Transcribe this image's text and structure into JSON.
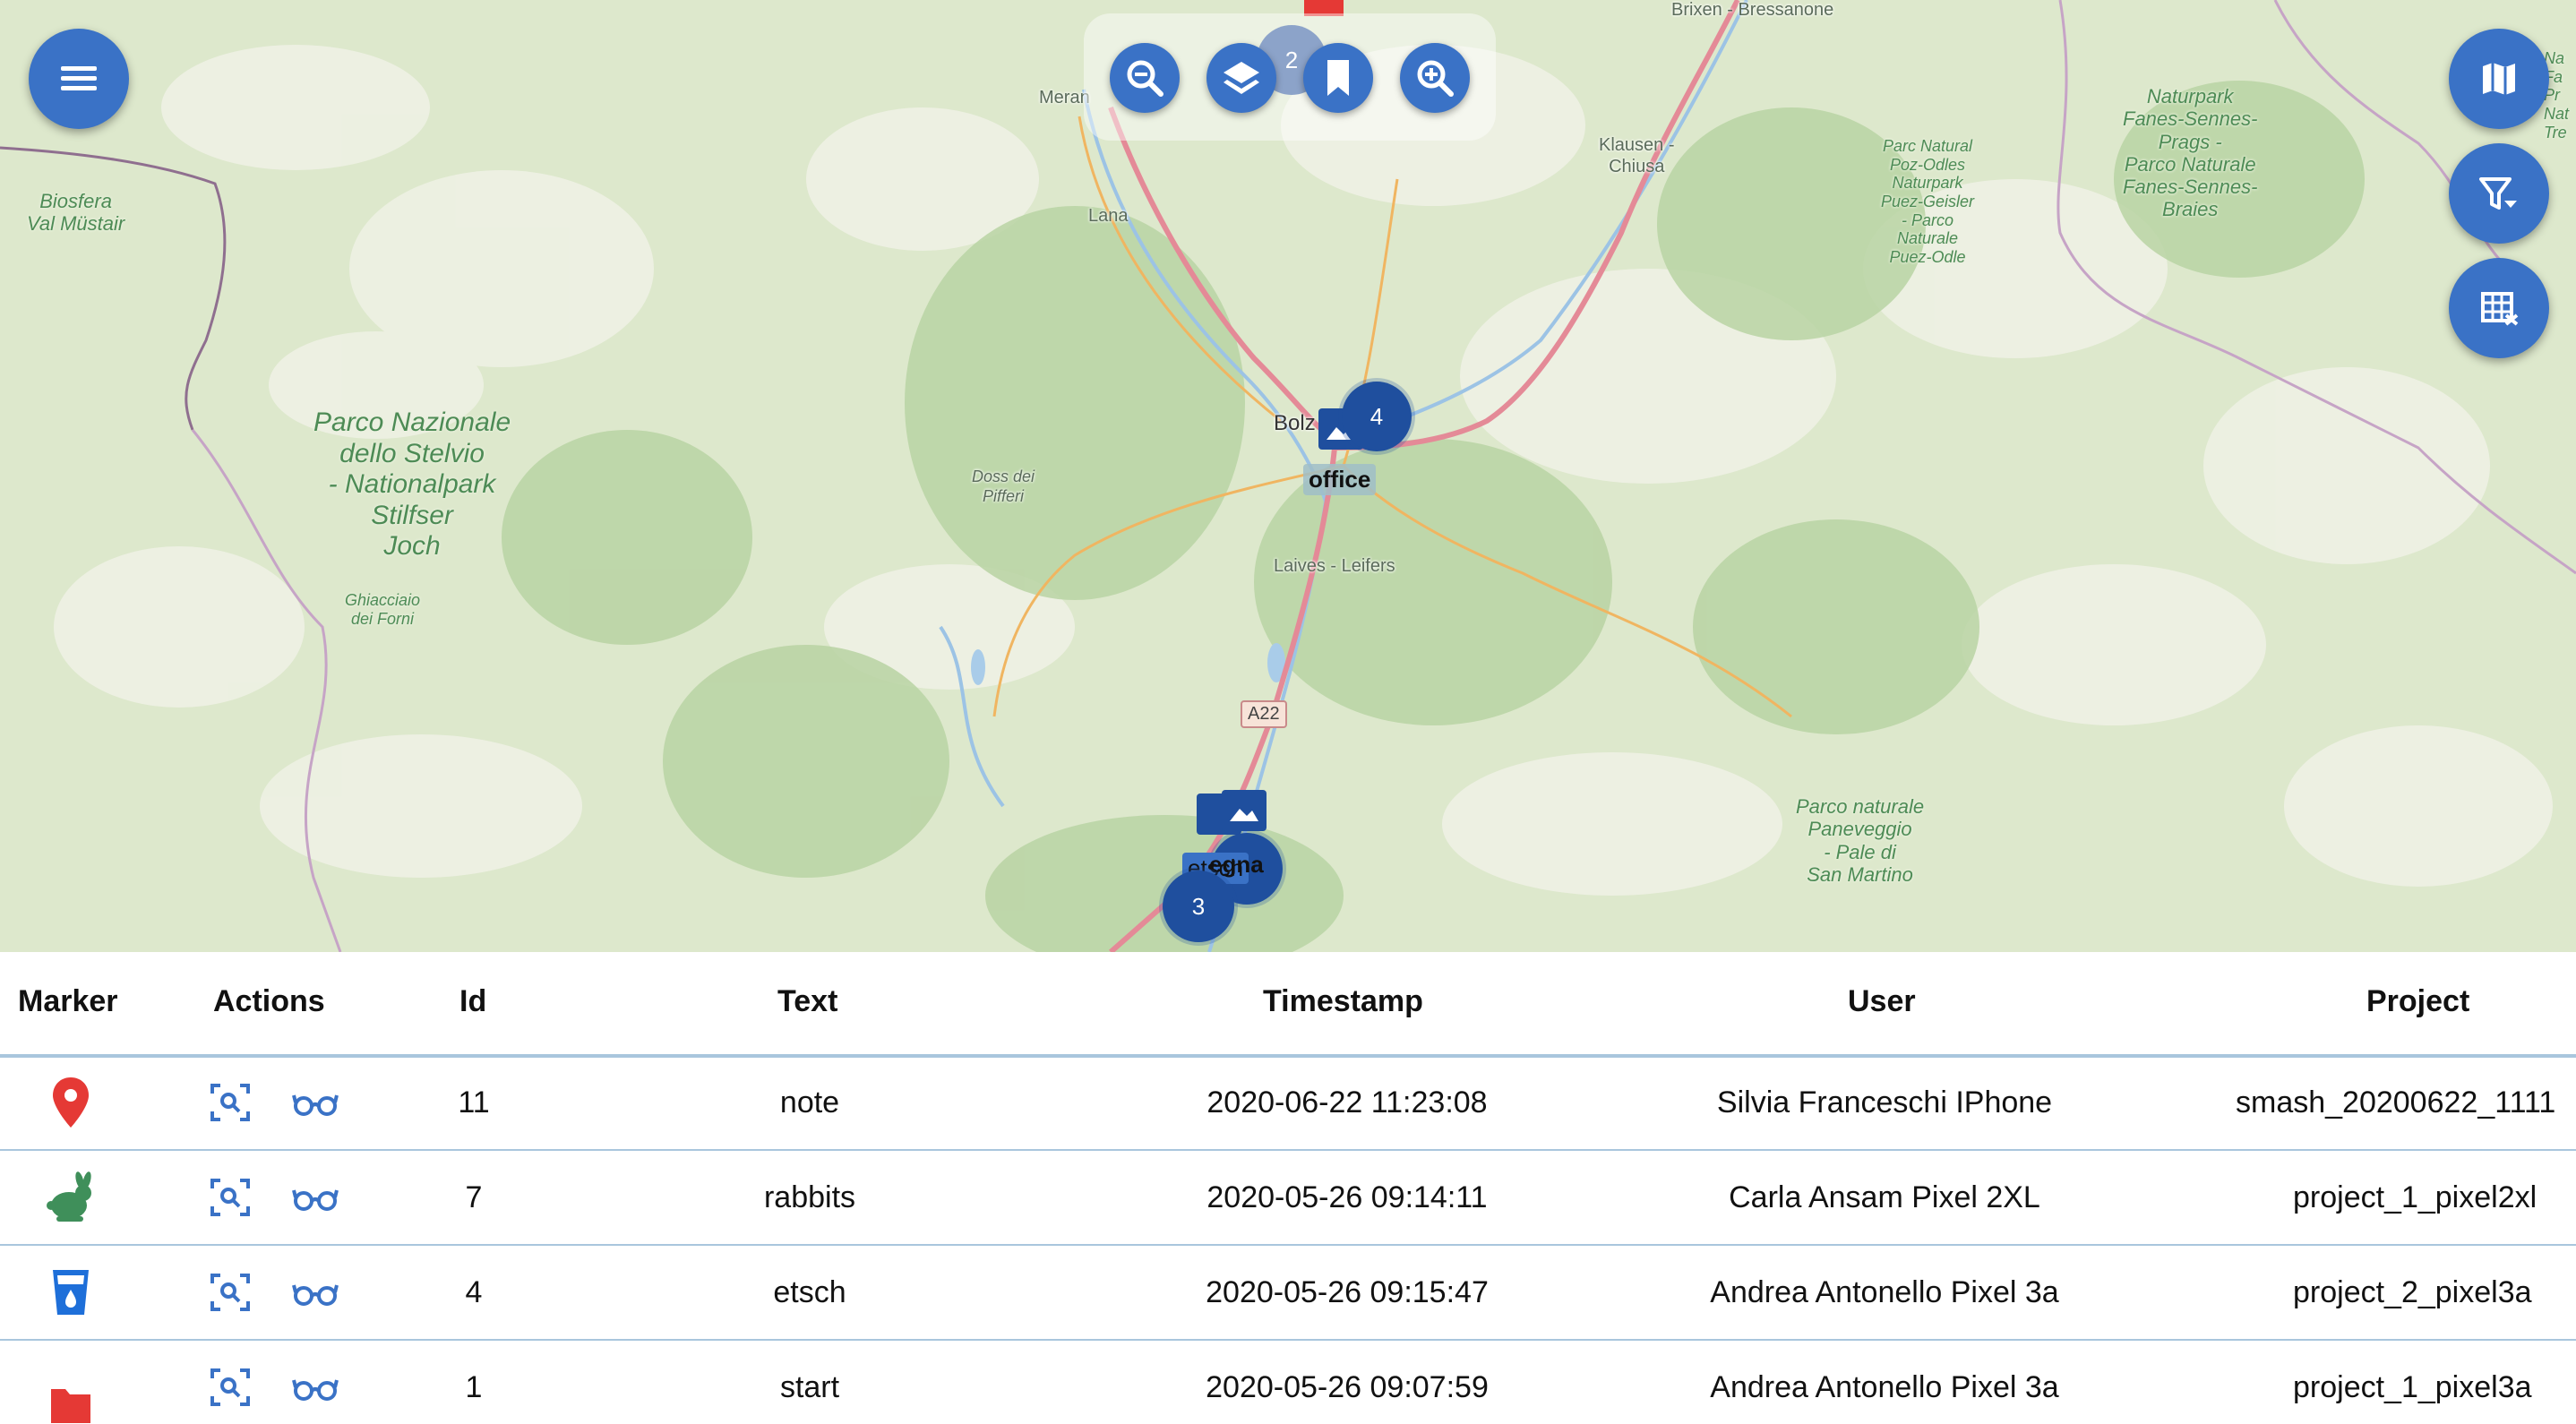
{
  "map": {
    "places": {
      "brixen": "Brixen - Bressanone",
      "meran": "Meran",
      "lana": "Lana",
      "klausen": "Klausen -\nChiusa",
      "bolzano": "Bolz     zen",
      "laives": "Laives - Leifers",
      "doss": "Doss dei\nPifferi",
      "ghiacciaio": "Ghiacciaio\ndei Forni"
    },
    "parks": {
      "biosfera": "Biosfera\nVal Müstair",
      "stelvio": "Parco Nazionale\ndello Stelvio\n- Nationalpark\nStilfser\nJoch",
      "fanes": "Naturpark\nFanes-Sennes-\nPrags -\nParco Naturale\nFanes-Sennes-\nBraies",
      "puez": "Parc Natural\nPoz-Odles\nNaturpark\nPuez-Geisler\n- Parco\nNaturale\nPuez-Odle",
      "paneveggio": "Parco naturale\nPaneveggio\n- Pale di\nSan Martino",
      "edge": "Na\nFa\nPr\nNat\nTre"
    },
    "road_shield": "A22",
    "clusters": {
      "top": "2",
      "bolzano": "4",
      "south": "3"
    },
    "labels": {
      "office": "office",
      "egna": "egna",
      "etsch": "etsch"
    }
  },
  "toolbar": {
    "zoom_out": "zoom-out",
    "layers": "layers",
    "bookmark": "bookmark",
    "zoom_in": "zoom-in"
  },
  "fabs": [
    "map",
    "filter",
    "table"
  ],
  "table": {
    "headers": [
      "Marker",
      "Actions",
      "Id",
      "Text",
      "Timestamp",
      "User",
      "Project"
    ],
    "rows": [
      {
        "marker": "map-pin-icon",
        "color": "#e53935",
        "id": "11",
        "text": "note",
        "timestamp": "2020-06-22 11:23:08",
        "user": "Silvia Franceschi IPhone",
        "project": "smash_20200622_1111"
      },
      {
        "marker": "rabbit-icon",
        "color": "#3f8f5a",
        "id": "7",
        "text": "rabbits",
        "timestamp": "2020-05-26 09:14:11",
        "user": "Carla Ansam Pixel 2XL",
        "project": "project_1_pixel2xl"
      },
      {
        "marker": "water-glass-icon",
        "color": "#1e6fd9",
        "id": "4",
        "text": "etsch",
        "timestamp": "2020-05-26 09:15:47",
        "user": "Andrea Antonello Pixel 3a",
        "project": "project_2_pixel3a"
      },
      {
        "marker": "folder-icon",
        "color": "#e53935",
        "id": "1",
        "text": "start",
        "timestamp": "2020-05-26 09:07:59",
        "user": "Andrea Antonello Pixel 3a",
        "project": "project_1_pixel3a"
      }
    ]
  },
  "colors": {
    "accent": "#3a72c6",
    "cluster": "#1f4f9e",
    "row_border": "#a9c6dd"
  }
}
